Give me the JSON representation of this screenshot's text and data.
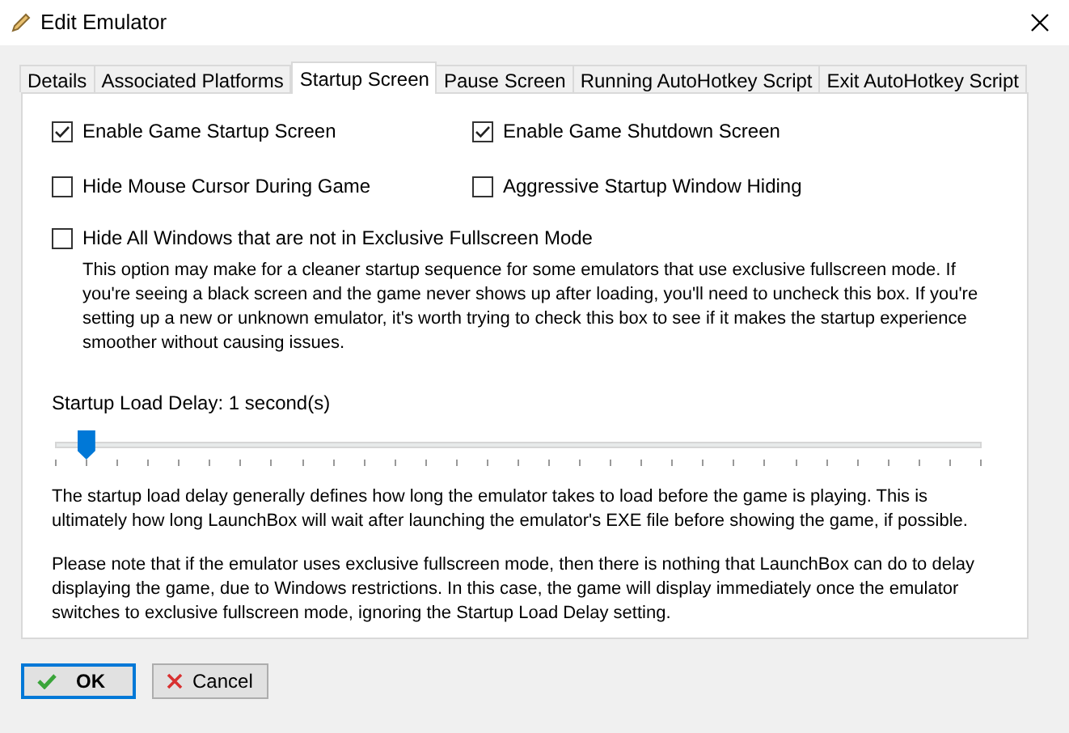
{
  "window": {
    "title": "Edit Emulator"
  },
  "tabs": [
    {
      "label": "Details",
      "selected": false
    },
    {
      "label": "Associated Platforms",
      "selected": false
    },
    {
      "label": "Startup Screen",
      "selected": true
    },
    {
      "label": "Pause Screen",
      "selected": false
    },
    {
      "label": "Running AutoHotkey Script",
      "selected": false
    },
    {
      "label": "Exit AutoHotkey Script",
      "selected": false
    }
  ],
  "options": [
    {
      "label": "Enable Game Startup Screen",
      "checked": true
    },
    {
      "label": "Enable Game Shutdown Screen",
      "checked": true
    },
    {
      "label": "Hide Mouse Cursor During Game",
      "checked": false
    },
    {
      "label": "Aggressive Startup Window Hiding",
      "checked": false
    }
  ],
  "hide_windows": {
    "label": "Hide All Windows that are not in Exclusive Fullscreen Mode",
    "checked": false,
    "description": "This option may make for a cleaner startup sequence for some emulators that use exclusive fullscreen mode. If you're seeing a black screen and the game never shows up after loading, you'll need to uncheck this box. If you're setting up a new or unknown emulator, it's worth trying to check this box to see if it makes the startup experience smoother without causing issues."
  },
  "load_delay": {
    "label": "Startup Load Delay: 1 second(s)",
    "level": 0.033
  },
  "notes": [
    "The startup load delay generally defines how long the emulator takes to load before the game is playing. This is ultimately how long LaunchBox will wait after launching the emulator's EXE file before showing the game, if possible.",
    "Please note that if the emulator uses exclusive fullscreen mode, then there is nothing that LaunchBox can do to delay displaying the game, due to Windows restrictions. In this case, the game will display immediately once the emulator switches to exclusive fullscreen mode, ignoring the Startup Load Delay setting."
  ],
  "buttons": [
    {
      "label": "OK",
      "kind": "ok"
    },
    {
      "label": "Cancel",
      "kind": "cancel"
    }
  ]
}
